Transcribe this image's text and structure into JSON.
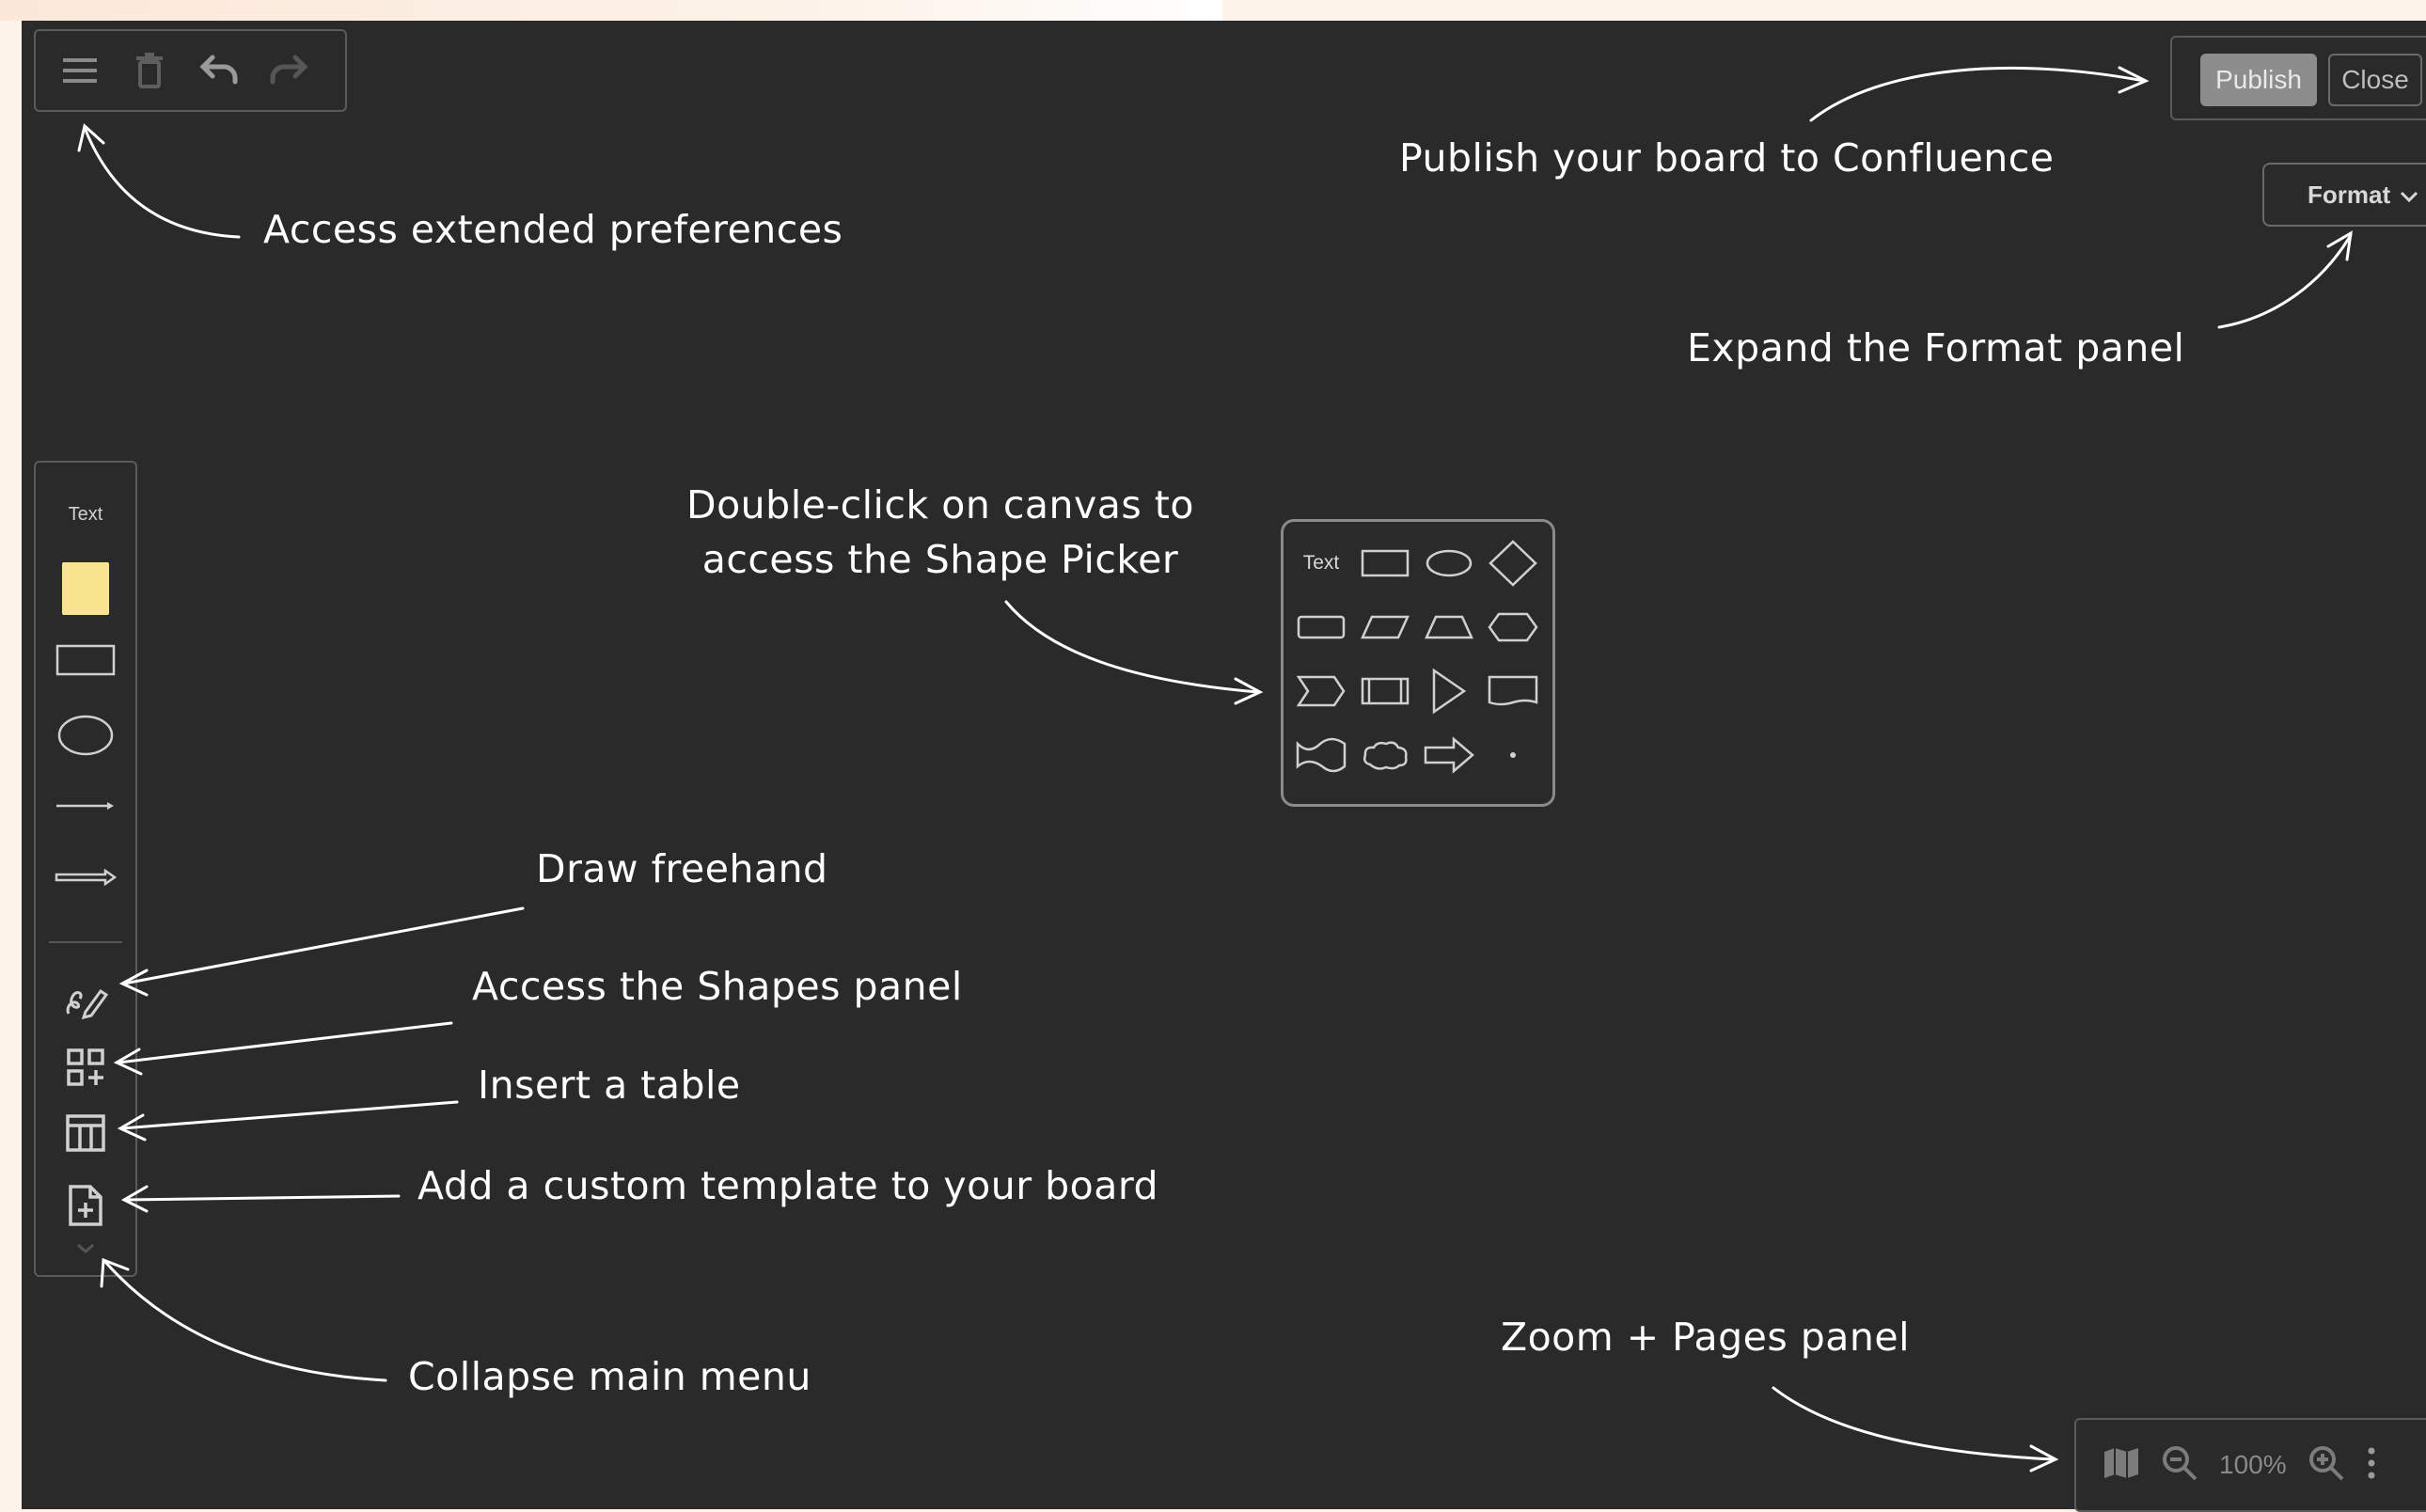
{
  "toolbar": {
    "menu_icon": "hamburger-menu-icon",
    "delete_icon": "trash-icon",
    "undo_icon": "undo-icon",
    "redo_icon": "redo-icon"
  },
  "publish_panel": {
    "publish_label": "Publish",
    "close_label": "Close"
  },
  "format": {
    "label": "Format",
    "chevron": "⌄"
  },
  "left_toolbar": {
    "text_label": "Text",
    "items": [
      "sticky-note-icon",
      "rectangle-icon",
      "ellipse-icon",
      "line-icon",
      "arrow-icon",
      "freehand-icon",
      "shapes-panel-icon",
      "table-icon",
      "template-icon",
      "chevron-down-icon"
    ]
  },
  "shape_picker": {
    "text_label": "Text"
  },
  "zoom_panel": {
    "zoom_value": "100%"
  },
  "annotations": {
    "preferences": "Access extended preferences",
    "publish": "Publish your board to Confluence",
    "format": "Expand the Format panel",
    "shape_picker_line1": "Double-click on canvas to",
    "shape_picker_line2": "access the Shape Picker",
    "freehand": "Draw freehand",
    "shapes_panel": "Access the Shapes panel",
    "table": "Insert a table",
    "template": "Add a custom template to your board",
    "collapse": "Collapse main menu",
    "zoom": "Zoom + Pages panel"
  },
  "colors": {
    "canvas": "#2a2a2a",
    "outer": "#fdf3ea",
    "sticky": "#f8e38e",
    "annotation_text": "#ffffff"
  }
}
